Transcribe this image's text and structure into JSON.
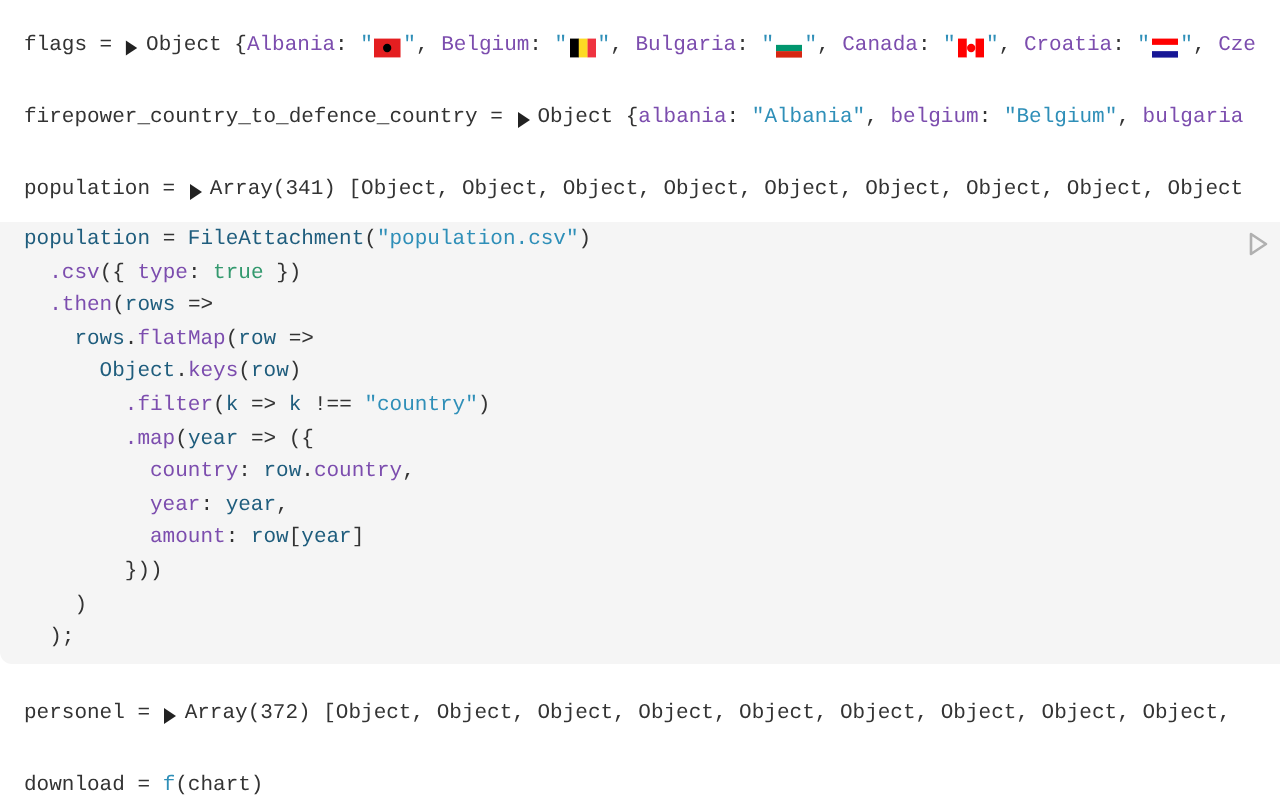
{
  "cells": [
    {
      "kind": "inspector",
      "name": "flags",
      "operator": "=",
      "expanded": false,
      "preview": [
        {
          "kind": "plain",
          "text": "Object {"
        },
        {
          "kind": "prop",
          "text": "Albania"
        },
        {
          "kind": "plain",
          "text": ": "
        },
        {
          "kind": "string",
          "text": "\""
        },
        {
          "kind": "flag"
        },
        {
          "kind": "string",
          "text": "\""
        },
        {
          "kind": "plain",
          "text": ", "
        },
        {
          "kind": "prop",
          "text": "Belgium"
        },
        {
          "kind": "plain",
          "text": ": "
        },
        {
          "kind": "string",
          "text": "\""
        },
        {
          "kind": "flag"
        },
        {
          "kind": "string",
          "text": "\""
        },
        {
          "kind": "plain",
          "text": ", "
        },
        {
          "kind": "prop",
          "text": "Bulgaria"
        },
        {
          "kind": "plain",
          "text": ": "
        },
        {
          "kind": "string",
          "text": "\""
        },
        {
          "kind": "flag"
        },
        {
          "kind": "string",
          "text": "\""
        },
        {
          "kind": "plain",
          "text": ", "
        },
        {
          "kind": "prop",
          "text": "Canada"
        },
        {
          "kind": "plain",
          "text": ": "
        },
        {
          "kind": "string",
          "text": "\""
        },
        {
          "kind": "flag"
        },
        {
          "kind": "string",
          "text": "\""
        },
        {
          "kind": "plain",
          "text": ", "
        },
        {
          "kind": "prop",
          "text": "Croatia"
        },
        {
          "kind": "plain",
          "text": ": "
        },
        {
          "kind": "string",
          "text": "\""
        },
        {
          "kind": "flag"
        },
        {
          "kind": "string",
          "text": "\""
        },
        {
          "kind": "plain",
          "text": ", "
        },
        {
          "kind": "prop",
          "text": "Cze"
        }
      ]
    },
    {
      "kind": "inspector",
      "name": "firepower_country_to_defence_country",
      "operator": "=",
      "expanded": false,
      "preview": [
        {
          "kind": "plain",
          "text": "Object {"
        },
        {
          "kind": "prop",
          "text": "albania"
        },
        {
          "kind": "plain",
          "text": ": "
        },
        {
          "kind": "string",
          "text": "\"Albania\""
        },
        {
          "kind": "plain",
          "text": ", "
        },
        {
          "kind": "prop",
          "text": "belgium"
        },
        {
          "kind": "plain",
          "text": ": "
        },
        {
          "kind": "string",
          "text": "\"Belgium\""
        },
        {
          "kind": "plain",
          "text": ", "
        },
        {
          "kind": "prop",
          "text": "bulgaria"
        }
      ]
    },
    {
      "kind": "inspector",
      "name": "population",
      "operator": "=",
      "expanded": false,
      "preview": [
        {
          "kind": "plain",
          "text": "Array(341) [Object, Object, Object, Object, Object, Object, Object, Object, Object"
        }
      ]
    },
    {
      "kind": "code",
      "lines": [
        [
          {
            "kind": "var",
            "text": "population"
          },
          {
            "kind": "plain",
            "text": " = "
          },
          {
            "kind": "var",
            "text": "FileAttachment"
          },
          {
            "kind": "plain",
            "text": "("
          },
          {
            "kind": "string",
            "text": "\"population.csv\""
          },
          {
            "kind": "plain",
            "text": ")"
          }
        ],
        [
          {
            "kind": "prop",
            "text": "  .csv"
          },
          {
            "kind": "plain",
            "text": "({ "
          },
          {
            "kind": "prop",
            "text": "type"
          },
          {
            "kind": "plain",
            "text": ": "
          },
          {
            "kind": "literal",
            "text": "true"
          },
          {
            "kind": "plain",
            "text": " })"
          }
        ],
        [
          {
            "kind": "prop",
            "text": "  .then"
          },
          {
            "kind": "plain",
            "text": "("
          },
          {
            "kind": "var",
            "text": "rows"
          },
          {
            "kind": "plain",
            "text": " =>"
          }
        ],
        [
          {
            "kind": "var",
            "text": "    rows"
          },
          {
            "kind": "plain",
            "text": "."
          },
          {
            "kind": "prop",
            "text": "flatMap"
          },
          {
            "kind": "plain",
            "text": "("
          },
          {
            "kind": "var",
            "text": "row"
          },
          {
            "kind": "plain",
            "text": " =>"
          }
        ],
        [
          {
            "kind": "var",
            "text": "      Object"
          },
          {
            "kind": "plain",
            "text": "."
          },
          {
            "kind": "prop",
            "text": "keys"
          },
          {
            "kind": "plain",
            "text": "("
          },
          {
            "kind": "var",
            "text": "row"
          },
          {
            "kind": "plain",
            "text": ")"
          }
        ],
        [
          {
            "kind": "prop",
            "text": "        .filter"
          },
          {
            "kind": "plain",
            "text": "("
          },
          {
            "kind": "var",
            "text": "k"
          },
          {
            "kind": "plain",
            "text": " => "
          },
          {
            "kind": "var",
            "text": "k"
          },
          {
            "kind": "plain",
            "text": " !== "
          },
          {
            "kind": "string",
            "text": "\"country\""
          },
          {
            "kind": "plain",
            "text": ")"
          }
        ],
        [
          {
            "kind": "prop",
            "text": "        .map"
          },
          {
            "kind": "plain",
            "text": "("
          },
          {
            "kind": "var",
            "text": "year"
          },
          {
            "kind": "plain",
            "text": " => ({"
          }
        ],
        [
          {
            "kind": "prop",
            "text": "          country"
          },
          {
            "kind": "plain",
            "text": ": "
          },
          {
            "kind": "var",
            "text": "row"
          },
          {
            "kind": "plain",
            "text": "."
          },
          {
            "kind": "prop",
            "text": "country"
          },
          {
            "kind": "plain",
            "text": ","
          }
        ],
        [
          {
            "kind": "prop",
            "text": "          year"
          },
          {
            "kind": "plain",
            "text": ": "
          },
          {
            "kind": "var",
            "text": "year"
          },
          {
            "kind": "plain",
            "text": ","
          }
        ],
        [
          {
            "kind": "prop",
            "text": "          amount"
          },
          {
            "kind": "plain",
            "text": ": "
          },
          {
            "kind": "var",
            "text": "row"
          },
          {
            "kind": "plain",
            "text": "["
          },
          {
            "kind": "var",
            "text": "year"
          },
          {
            "kind": "plain",
            "text": "]"
          }
        ],
        [
          {
            "kind": "plain",
            "text": "        }))"
          }
        ],
        [
          {
            "kind": "plain",
            "text": "    )"
          }
        ],
        [
          {
            "kind": "plain",
            "text": "  );"
          }
        ]
      ]
    },
    {
      "kind": "inspector",
      "name": "personel",
      "operator": "=",
      "expanded": false,
      "preview": [
        {
          "kind": "plain",
          "text": "Array(372) [Object, Object, Object, Object, Object, Object, Object, Object, Object,"
        }
      ]
    },
    {
      "kind": "plain",
      "tokens": [
        {
          "kind": "plain",
          "text": "download = "
        },
        {
          "kind": "fn",
          "text": "f"
        },
        {
          "kind": "plain",
          "text": "(chart)"
        }
      ]
    }
  ]
}
